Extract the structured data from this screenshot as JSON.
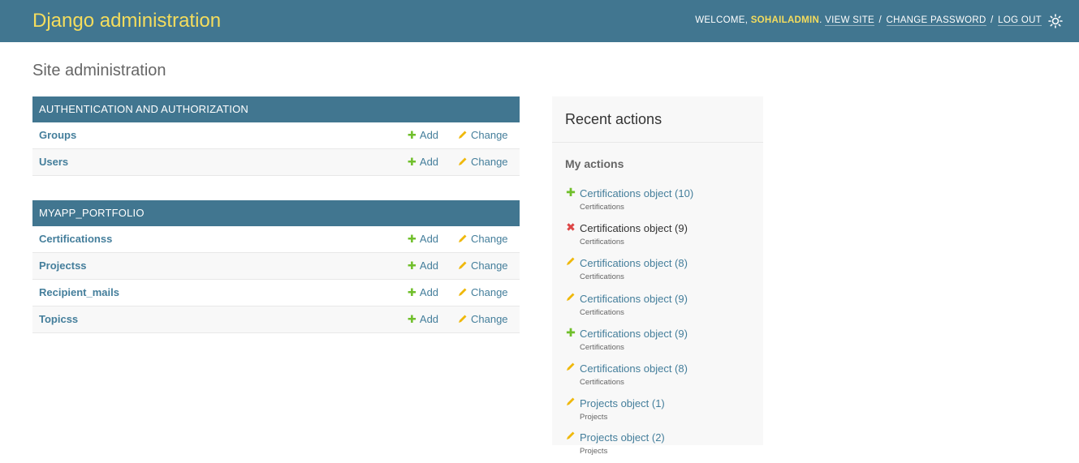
{
  "header": {
    "brand": "Django administration",
    "welcome": "Welcome,",
    "username": "sohailadmin",
    "period": ".",
    "view_site": "View site",
    "change_password": "Change password",
    "log_out": "Log out",
    "sep": "/",
    "theme_icon": "sun-icon"
  },
  "page": {
    "title": "Site administration"
  },
  "apps": [
    {
      "caption": "Authentication and Authorization",
      "models": [
        {
          "name": "Groups",
          "add": "Add",
          "change": "Change"
        },
        {
          "name": "Users",
          "add": "Add",
          "change": "Change"
        }
      ]
    },
    {
      "caption": "MYAPP_PORTFOLIO",
      "models": [
        {
          "name": "Certificationss",
          "add": "Add",
          "change": "Change"
        },
        {
          "name": "Projectss",
          "add": "Add",
          "change": "Change"
        },
        {
          "name": "Recipient_mails",
          "add": "Add",
          "change": "Change"
        },
        {
          "name": "Topicss",
          "add": "Add",
          "change": "Change"
        }
      ]
    }
  ],
  "recent_actions": {
    "title": "Recent actions",
    "subtitle": "My actions",
    "items": [
      {
        "type": "add",
        "object": "Certifications object (10)",
        "content_type": "Certifications"
      },
      {
        "type": "delete",
        "object": "Certifications object (9)",
        "content_type": "Certifications"
      },
      {
        "type": "change",
        "object": "Certifications object (8)",
        "content_type": "Certifications"
      },
      {
        "type": "change",
        "object": "Certifications object (9)",
        "content_type": "Certifications"
      },
      {
        "type": "add",
        "object": "Certifications object (9)",
        "content_type": "Certifications"
      },
      {
        "type": "change",
        "object": "Certifications object (8)",
        "content_type": "Certifications"
      },
      {
        "type": "change",
        "object": "Projects object (1)",
        "content_type": "Projects"
      },
      {
        "type": "change",
        "object": "Projects object (2)",
        "content_type": "Projects"
      }
    ]
  },
  "colors": {
    "header_bg": "#417690",
    "brand": "#f5dd5d",
    "link": "#447e9b",
    "add_green": "#70bf2b",
    "change_yellow": "#efb80b",
    "delete_red": "#dd4646"
  }
}
